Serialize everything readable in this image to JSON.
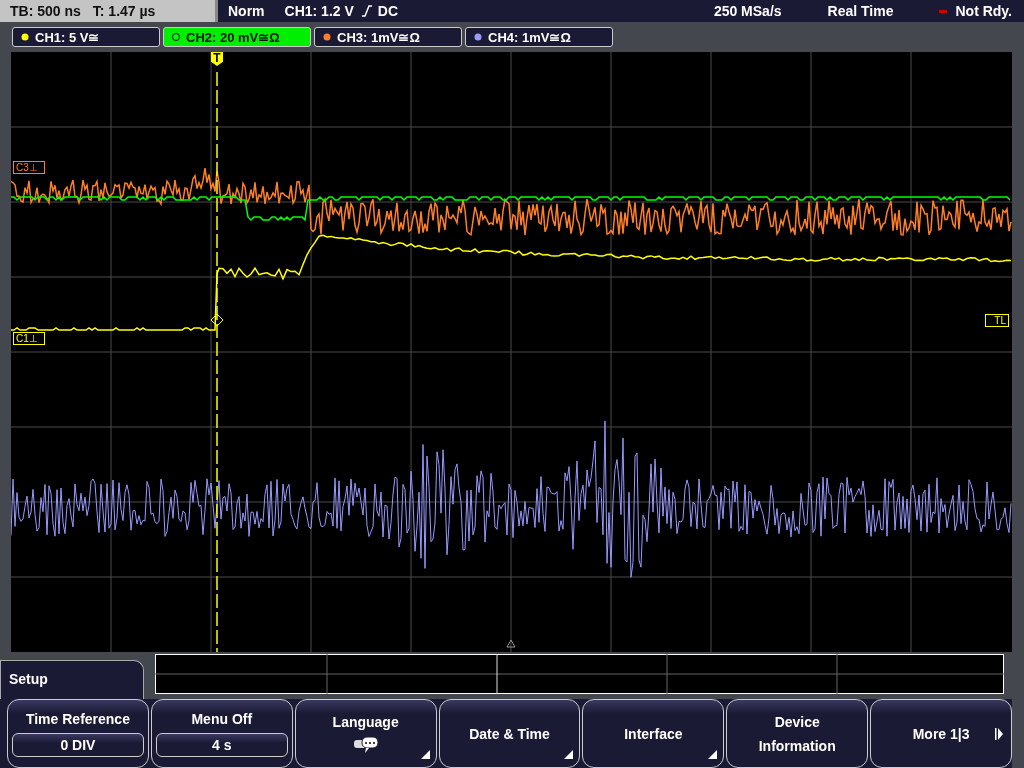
{
  "status_bar": {
    "timebase": "TB: 500 ns",
    "trigger_time": "T: 1.47 µs",
    "mode": "Norm",
    "trigger_source": "CH1: 1.2 V",
    "trigger_coupling": "DC",
    "sample_rate": "250 MSa/s",
    "acquisition": "Real Time",
    "state": "Not Rdy."
  },
  "channels": [
    {
      "label": "CH1: 5 V≅",
      "color": "#ffff00",
      "selected": false
    },
    {
      "label": "CH2: 20 mV≅Ω",
      "color": "#00ff00",
      "selected": true
    },
    {
      "label": "CH3: 1mV≅Ω",
      "color": "#ff7f27",
      "selected": false
    },
    {
      "label": "CH4: 1mV≅Ω",
      "color": "#9999ff",
      "selected": false
    }
  ],
  "markers": {
    "trigger": "T",
    "trigger_level": "TL",
    "ch3": "C3⊥",
    "ch1": "C1⊥"
  },
  "menu": {
    "title": "Setup",
    "buttons": [
      {
        "kind": "value",
        "label": "Time Reference",
        "value": "0 DIV"
      },
      {
        "kind": "value",
        "label": "Menu Off",
        "value": "4 s"
      },
      {
        "kind": "icon",
        "label": "Language"
      },
      {
        "kind": "submenu",
        "label": "Date & Time"
      },
      {
        "kind": "submenu",
        "label": "Interface"
      },
      {
        "kind": "plain",
        "label": "Device Information"
      },
      {
        "kind": "more",
        "label": "More 1|3"
      }
    ]
  }
}
